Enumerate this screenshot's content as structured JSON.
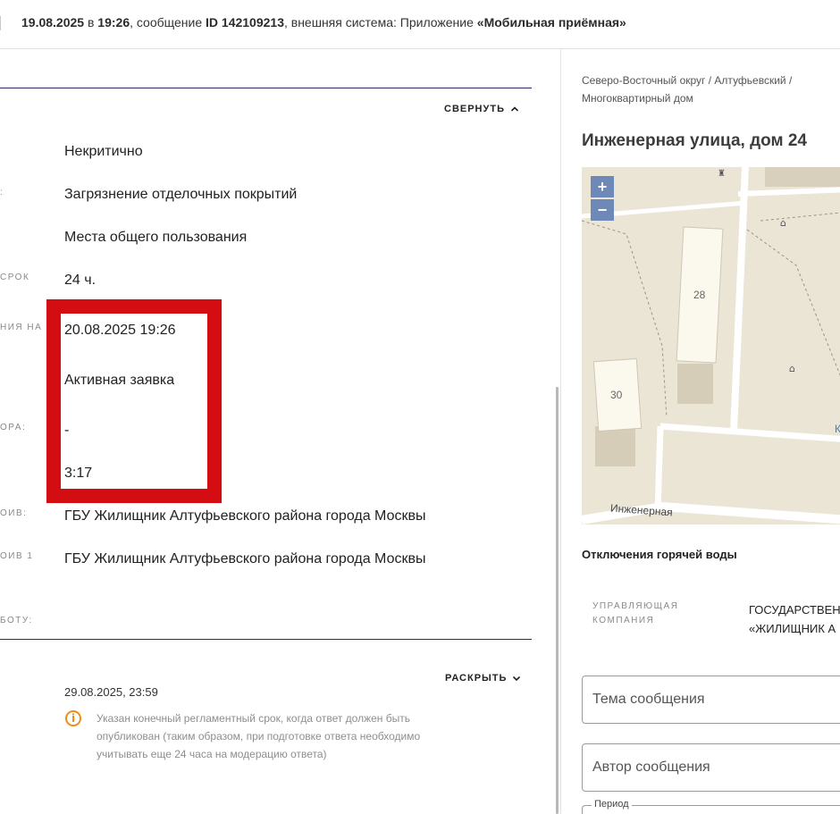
{
  "header": {
    "date": "19.08.2025",
    "at": " в ",
    "time": "19:26",
    "message_prefix": ", сообщение ",
    "message_id": "ID 142109213",
    "system_prefix": ", внешняя система: Приложение ",
    "system_name": "«Мобильная приёмная»"
  },
  "details": {
    "collapse_label": "СВЕРНУТЬ",
    "labels": {
      "l1": "",
      "l2": "СРОК",
      "l3": "НИЯ НА",
      "l4": "ОРА:",
      "l5": "ОИВ:",
      "l6": "ОИВ 1",
      "l7": "БОТУ:"
    },
    "values": {
      "criticality": "Некритично",
      "problem": "Загрязнение отделочных покрытий",
      "location": "Места общего пользования",
      "deadline": "24 ч.",
      "due_date": "20.08.2025 19:26",
      "status": "Активная заявка",
      "dash": "-",
      "duration": "3:17",
      "oiv": "ГБУ Жилищник Алтуфьевского района города Москвы",
      "oiv1": "ГБУ Жилищник Алтуфьевского района города Москвы"
    },
    "highlight_color": "#d40d12"
  },
  "section2": {
    "expand_label": "РАСКРЫТЬ",
    "deadline_date": "29.08.2025, 23:59",
    "info_text": "Указан конечный регламентный срок, когда ответ должен быть опубликован (таким образом, при подготовке ответа необходимо учитывать еще 24 часа на модерацию ответа)",
    "info_icon": "info-icon",
    "info_color": "#f28c18"
  },
  "right": {
    "breadcrumb": "Северо-Восточный округ / Алтуфьевский / Многоквартирный дом",
    "address": "Инженерная улица, дом 24",
    "map": {
      "zoom_in": "+",
      "zoom_out": "−",
      "building_28": "28",
      "building_30": "30",
      "street": "Инженерная",
      "edge_letter": "К"
    },
    "hot_water": "Отключения горячей воды",
    "mc_label_1": "УПРАВЛЯЮЩАЯ",
    "mc_label_2": "КОМПАНИЯ",
    "mc_value_1": "ГОСУДАРСТВЕН",
    "mc_value_2": "«ЖИЛИЩНИК А",
    "topic_placeholder": "Тема сообщения",
    "author_placeholder": "Автор сообщения",
    "period_label": "Период"
  }
}
